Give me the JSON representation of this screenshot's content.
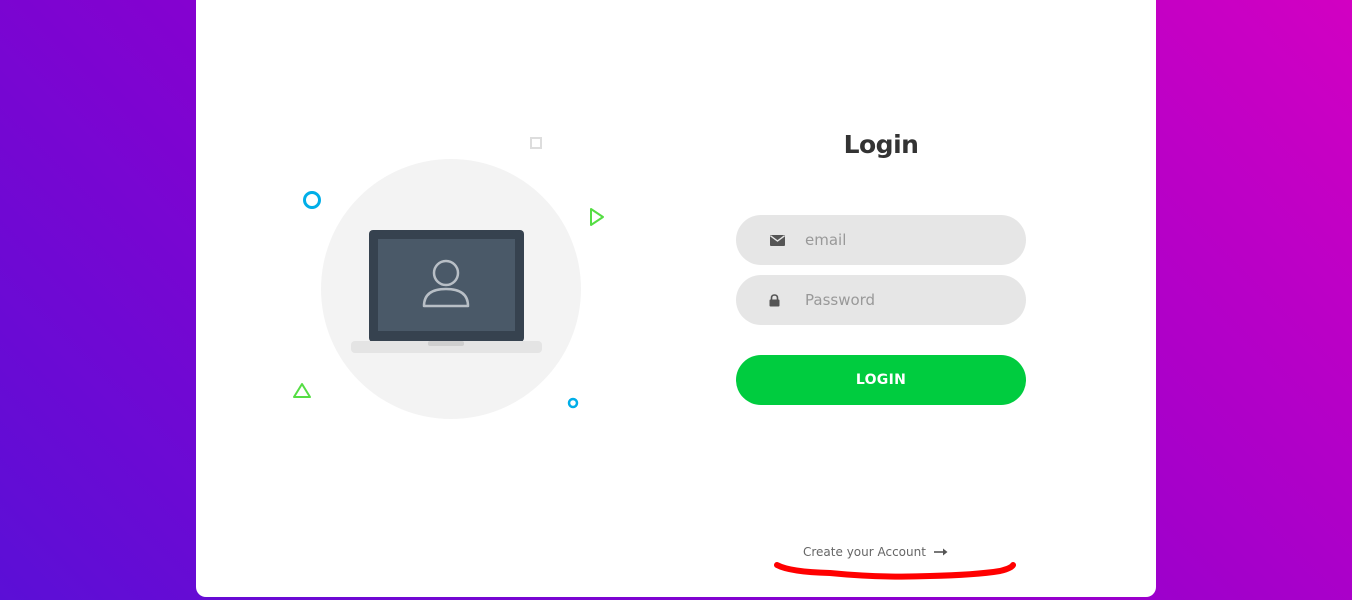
{
  "login": {
    "title": "Login",
    "email_placeholder": "email",
    "password_placeholder": "Password",
    "submit_label": "LOGIN",
    "create_account_label": "Create your Account"
  },
  "icons": {
    "email": "envelope-icon",
    "password": "lock-icon",
    "create_account": "arrow-right-icon",
    "illustration": "laptop-user-icon"
  },
  "colors": {
    "background_gradient": [
      "#5b0fd6",
      "#8a00cf",
      "#d200c2"
    ],
    "card": "#ffffff",
    "input_bg": "#e6e6e6",
    "button": "#00cc3f",
    "title": "#333333",
    "annotation_underline": "#ff0000",
    "deco_blue": "#00aee8",
    "deco_green": "#55dd44",
    "deco_gray": "#dddddd"
  }
}
